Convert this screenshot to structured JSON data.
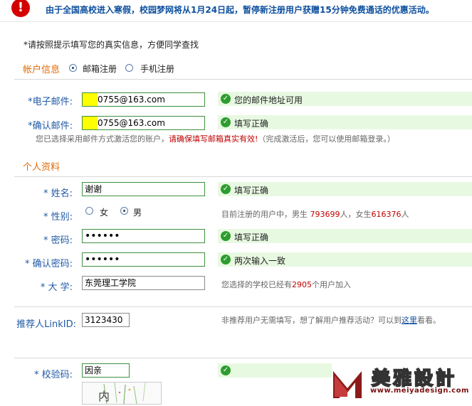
{
  "notice": {
    "icon": "warning-icon",
    "text": "由于全国高校进入寒假，校园梦网将从1月24日起，暂停新注册用户获赠15分钟免费通话的优惠活动。"
  },
  "instruction": "*请按照提示填写您的真实信息，方便同学查找",
  "account": {
    "title": "帐户信息",
    "options": [
      {
        "label": "邮箱注册",
        "selected": true
      },
      {
        "label": "手机注册",
        "selected": false
      }
    ],
    "email": {
      "label": "*电子邮件:",
      "value": "0755@163.com",
      "status": "您的邮件地址可用"
    },
    "confirm_email": {
      "label": "*确认邮件:",
      "value": "0755@163.com",
      "status": "填写正确"
    },
    "note": {
      "before": "您已选择采用邮件方式激活您的账户，",
      "highlight": "请确保填写邮箱真实有效!",
      "after": "（完成激活后，您可以使用邮箱登录。）"
    }
  },
  "personal": {
    "title": "个人资料",
    "name": {
      "label": "* 姓名:",
      "value": "谢谢",
      "status": "填写正确"
    },
    "gender": {
      "label": "* 性别:",
      "options": [
        {
          "label": "女",
          "selected": false
        },
        {
          "label": "男",
          "selected": true
        }
      ],
      "stats": {
        "prefix": "目前注册的用户中，男生",
        "male_count": "793699",
        "middle": "人，女生",
        "female_count": "616376",
        "suffix": "人"
      }
    },
    "password": {
      "label": "* 密码:",
      "value": "••••••",
      "status": "填写正确"
    },
    "confirm_password": {
      "label": "* 确认密码:",
      "value": "••••••",
      "status": "两次输入一致"
    },
    "university": {
      "label": "* 大 学:",
      "value": "东莞理工学院",
      "note_prefix": "您选择的学校已经有",
      "count": "2905",
      "note_suffix": "个用户加入"
    }
  },
  "referrer": {
    "label": "推荐人LinkID:",
    "value": "3123430",
    "note_prefix": "非推荐用户无需填写，想了解用户推荐活动？可以到",
    "link": "这里",
    "note_suffix": "看看。"
  },
  "captcha": {
    "label": "* 校验码:",
    "value": "因亲",
    "image_char": "内"
  },
  "watermark": {
    "name": "美雅設計",
    "url": "www.meiyadesign.com"
  },
  "colors": {
    "notice_text": "#0d4f9e",
    "label_blue": "#1f5aa6",
    "section_orange": "#e36c0a",
    "ok_green": "#2e9d2e",
    "status_bg": "#e8f9e2",
    "warning_red": "#d40000"
  }
}
